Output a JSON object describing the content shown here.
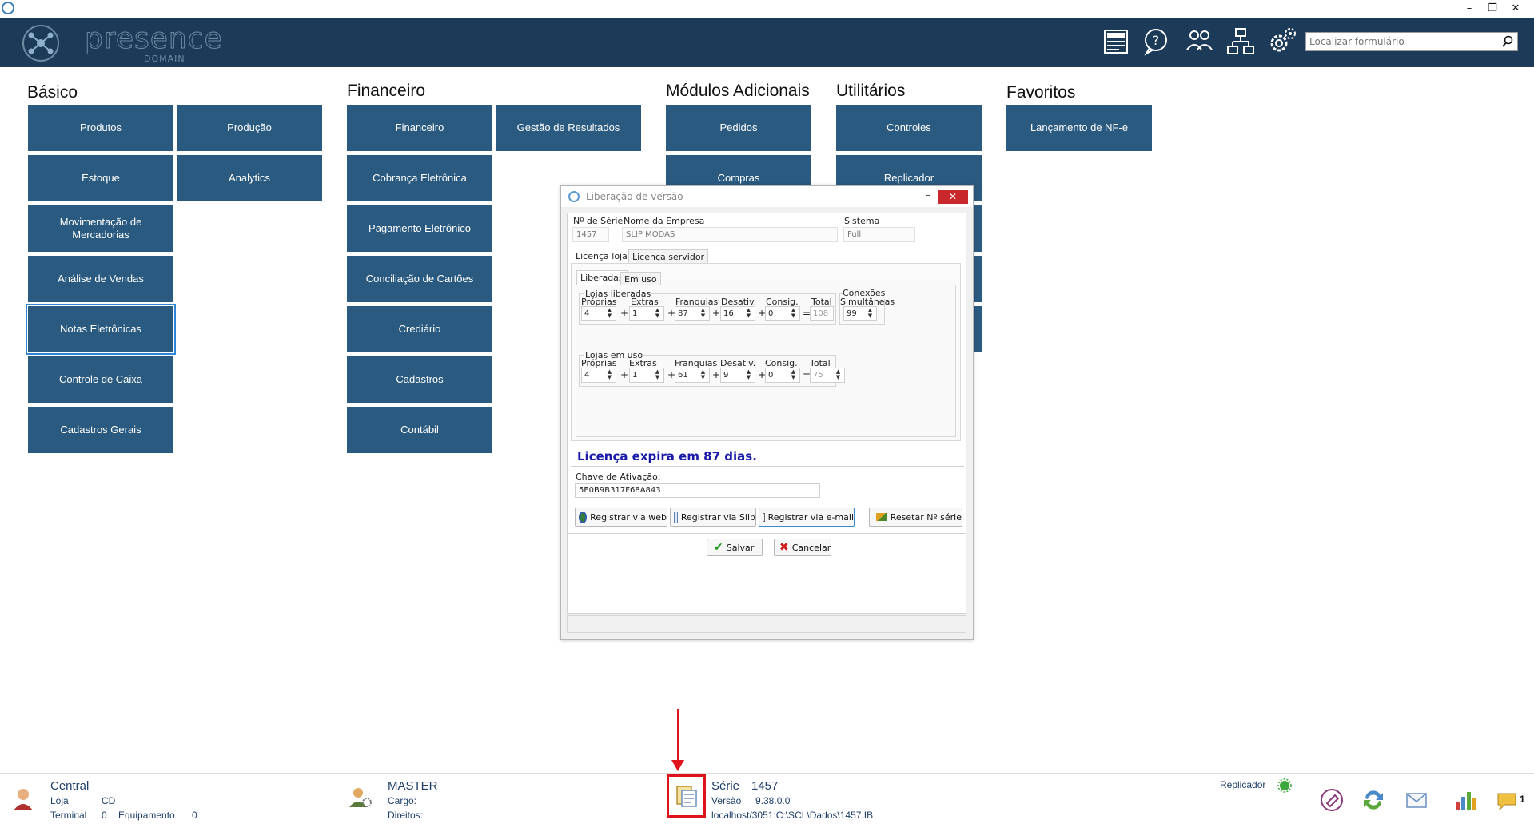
{
  "header": {
    "logo_text": "presence",
    "logo_sub": "DOMAIN",
    "search_placeholder": "Localizar formulário",
    "icons": [
      "news-icon",
      "help-icon",
      "users-icon",
      "network-icon",
      "settings-icon"
    ]
  },
  "sections": {
    "basico": {
      "title": "Básico",
      "tiles": [
        "Produtos",
        "Produção",
        "Estoque",
        "Analytics",
        "Movimentação de Mercadorias",
        "Análise de Vendas",
        "Notas Eletrônicas",
        "Controle de Caixa",
        "Cadastros Gerais"
      ]
    },
    "financeiro": {
      "title": "Financeiro",
      "tiles": [
        "Financeiro",
        "Gestão de Resultados",
        "Cobrança Eletrônica",
        "Pagamento Eletrônico",
        "Conciliação de Cartões",
        "Crediário",
        "Cadastros",
        "Contábil"
      ]
    },
    "modulos": {
      "title": "Módulos Adicionais",
      "tiles": [
        "Pedidos",
        "Compras"
      ]
    },
    "utilitarios": {
      "title": "Utilitários",
      "tiles": [
        "Controles",
        "Replicador"
      ]
    },
    "favoritos": {
      "title": "Favoritos",
      "tiles": [
        "Lançamento de NF-e"
      ]
    }
  },
  "dialog": {
    "title": "Liberação de versão",
    "serie_label": "Nº de Série",
    "serie_value": "1457",
    "empresa_label": "Nome da Empresa",
    "empresa_value": "SLIP MODAS",
    "sistema_label": "Sistema",
    "sistema_value": "Full",
    "tabs": [
      "Licença lojas",
      "Licença servidor"
    ],
    "subtabs": [
      "Liberadas",
      "Em uso"
    ],
    "liberadas": {
      "group": "Lojas liberadas",
      "cols": [
        "Próprias",
        "Extras",
        "Franquias",
        "Desativ.",
        "Consig.",
        "Total"
      ],
      "values": [
        "4",
        "1",
        "87",
        "16",
        "0",
        "108"
      ]
    },
    "conexoes": {
      "label1": "Conexões",
      "label2": "Simultâneas",
      "value": "99"
    },
    "em_uso": {
      "group": "Lojas em uso",
      "cols": [
        "Próprias",
        "Extras",
        "Franquias",
        "Desativ.",
        "Consig.",
        "Total"
      ],
      "values": [
        "4",
        "1",
        "61",
        "9",
        "0",
        "75"
      ]
    },
    "ops": [
      "+",
      "+",
      "+",
      "+",
      "="
    ],
    "expire_text": "Licença expira em 87 dias.",
    "chave_label": "Chave de Ativação:",
    "chave_value": "5E0B9B317F68A843",
    "buttons": {
      "web": "Registrar via web",
      "slip": "Registrar via Slip",
      "email": "Registrar via e-mail",
      "reset": "Resetar Nº série",
      "salvar": "Salvar",
      "cancelar": "Cancelar"
    }
  },
  "status": {
    "central": "Central",
    "loja_label": "Loja",
    "loja_value": "CD",
    "terminal_label": "Terminal",
    "terminal_value": "0",
    "equipamento_label": "Equipamento",
    "equipamento_value": "0",
    "user": "MASTER",
    "cargo_label": "Cargo:",
    "direitos_label": "Direitos:",
    "serie_label": "Série",
    "serie_value": "1457",
    "versao_label": "Versão",
    "versao_value": "9.38.0.0",
    "db_path": "localhost/3051:C:\\SCL\\Dados\\1457.IB",
    "replicador": "Replicador",
    "notif_count": "1"
  },
  "colors": {
    "header_bg": "#1c3b59",
    "tile_bg": "#2a5a80",
    "expire_text": "#1a1aa8",
    "highlight": "#e0131d"
  }
}
